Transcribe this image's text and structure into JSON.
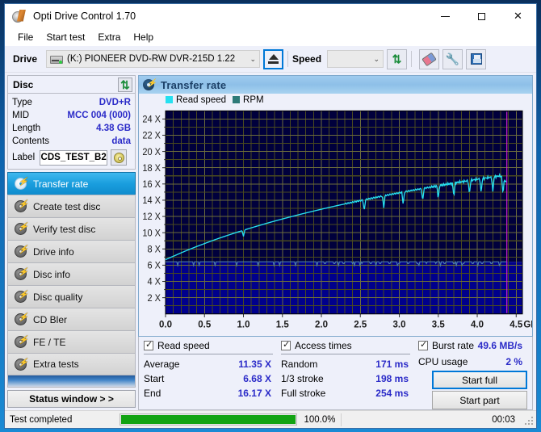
{
  "window": {
    "title": "Opti Drive Control 1.70",
    "icon": "app-disc-icon",
    "minimize": "—",
    "maximize": "□",
    "close": "✕"
  },
  "menu": [
    "File",
    "Start test",
    "Extra",
    "Help"
  ],
  "toolbar": {
    "drive_label": "Drive",
    "drive_value": "(K:)  PIONEER DVD-RW  DVR-215D 1.22",
    "eject_icon": "eject-icon",
    "speed_label": "Speed",
    "speed_value": "",
    "refresh_icon": "refresh-icon",
    "eraser_icon": "eraser-icon",
    "tools_icon": "wrench-icon",
    "save_icon": "save-floppy-icon"
  },
  "disc": {
    "header": "Disc",
    "refresh_icon": "refresh-icon",
    "rows": [
      {
        "key": "Type",
        "value": "DVD+R"
      },
      {
        "key": "MID",
        "value": "MCC 004 (000)"
      },
      {
        "key": "Length",
        "value": "4.38 GB"
      },
      {
        "key": "Contents",
        "value": "data"
      }
    ],
    "label_key": "Label",
    "label_value": "CDS_TEST_B2",
    "label_button_icon": "cd-disc-icon"
  },
  "sidebar": {
    "items": [
      {
        "label": "Transfer rate",
        "active": true
      },
      {
        "label": "Create test disc",
        "active": false
      },
      {
        "label": "Verify test disc",
        "active": false
      },
      {
        "label": "Drive info",
        "active": false
      },
      {
        "label": "Disc info",
        "active": false
      },
      {
        "label": "Disc quality",
        "active": false
      },
      {
        "label": "CD Bler",
        "active": false
      },
      {
        "label": "FE / TE",
        "active": false
      },
      {
        "label": "Extra tests",
        "active": false
      }
    ],
    "status_window_button": "Status window > >"
  },
  "panel": {
    "title": "Transfer rate",
    "icon": "disc-bolt-icon"
  },
  "results": {
    "read_speed": {
      "checkbox_label": "Read speed",
      "checked": true,
      "rows": [
        {
          "key": "Average",
          "value": "11.35 X"
        },
        {
          "key": "Start",
          "value": "6.68 X"
        },
        {
          "key": "End",
          "value": "16.17 X"
        }
      ]
    },
    "access_times": {
      "checkbox_label": "Access times",
      "checked": true,
      "rows": [
        {
          "key": "Random",
          "value": "171 ms"
        },
        {
          "key": "1/3 stroke",
          "value": "198 ms"
        },
        {
          "key": "Full stroke",
          "value": "254 ms"
        }
      ]
    },
    "burst": {
      "checkbox_label": "Burst rate",
      "checked": true,
      "value": "49.6 MB/s",
      "cpu_key": "CPU usage",
      "cpu_value": "2 %"
    },
    "buttons": {
      "start_full": "Start full",
      "start_part": "Start part"
    }
  },
  "statusbar": {
    "message": "Test completed",
    "progress_percent": 100.0,
    "progress_text": "100.0%",
    "elapsed": "00:03"
  },
  "colors": {
    "read_speed": "#26e0f0",
    "rpm": "#4c7fa8",
    "plot_bg_top": "#00003c",
    "plot_bg_bottom": "#00008c",
    "grid": "#4a4a1e",
    "marker": "#d020d0",
    "accent": "#2b2bc8",
    "progress": "#12a312"
  },
  "chart_data": {
    "type": "line",
    "title": "Transfer rate",
    "xlabel": "GB",
    "ylabel": "X",
    "xlim": [
      0.0,
      4.58
    ],
    "ylim": [
      0.0,
      25.0
    ],
    "xticks": [
      "0.0",
      "0.5",
      "1.0",
      "1.5",
      "2.0",
      "2.5",
      "3.0",
      "3.5",
      "4.0",
      "4.5"
    ],
    "xtick_values": [
      0.0,
      0.5,
      1.0,
      1.5,
      2.0,
      2.5,
      3.0,
      3.5,
      4.0,
      4.5
    ],
    "yticks": [
      "2 X",
      "4 X",
      "6 X",
      "8 X",
      "10 X",
      "12 X",
      "14 X",
      "16 X",
      "18 X",
      "20 X",
      "22 X",
      "24 X"
    ],
    "ytick_values": [
      2,
      4,
      6,
      8,
      10,
      12,
      14,
      16,
      18,
      20,
      22,
      24
    ],
    "grid": true,
    "legend_position": "top-left",
    "x_unit_suffix": "GB",
    "end_marker_x": 4.38,
    "series": [
      {
        "name": "Read speed",
        "color": "#26e0f0",
        "x": [
          0.0,
          0.1,
          0.2,
          0.3,
          0.4,
          0.5,
          0.6,
          0.7,
          0.8,
          0.9,
          1.0,
          1.1,
          1.2,
          1.3,
          1.4,
          1.5,
          1.6,
          1.7,
          1.8,
          1.9,
          2.0,
          2.1,
          2.2,
          2.3,
          2.4,
          2.5,
          2.6,
          2.7,
          2.8,
          2.9,
          3.0,
          3.1,
          3.2,
          3.3,
          3.4,
          3.5,
          3.6,
          3.7,
          3.8,
          3.9,
          4.0,
          4.1,
          4.2,
          4.3,
          4.38
        ],
        "values": [
          6.68,
          7.1,
          7.52,
          7.92,
          8.3,
          8.66,
          9.02,
          9.36,
          9.68,
          10.0,
          10.3,
          10.6,
          10.88,
          11.16,
          11.43,
          11.69,
          11.94,
          12.19,
          12.43,
          12.66,
          12.89,
          13.11,
          13.33,
          13.54,
          13.75,
          13.95,
          14.15,
          14.35,
          14.54,
          14.73,
          14.91,
          15.09,
          15.27,
          15.44,
          15.61,
          15.78,
          15.95,
          16.11,
          16.27,
          16.42,
          16.57,
          16.72,
          16.86,
          17.0,
          16.17
        ],
        "dropouts_x": [
          1.0,
          2.55,
          2.8,
          3.05,
          3.3,
          3.5,
          3.7,
          3.9,
          4.05,
          4.2,
          4.33
        ],
        "unit": "X"
      },
      {
        "name": "RPM",
        "color": "#4c7fa8",
        "x": [
          0.0,
          0.5,
          1.0,
          1.5,
          2.0,
          2.5,
          3.0,
          3.5,
          4.0,
          4.38
        ],
        "values": [
          6.42,
          6.42,
          6.42,
          6.42,
          6.42,
          6.42,
          6.42,
          6.42,
          6.42,
          6.42
        ],
        "unit": "X"
      }
    ]
  }
}
